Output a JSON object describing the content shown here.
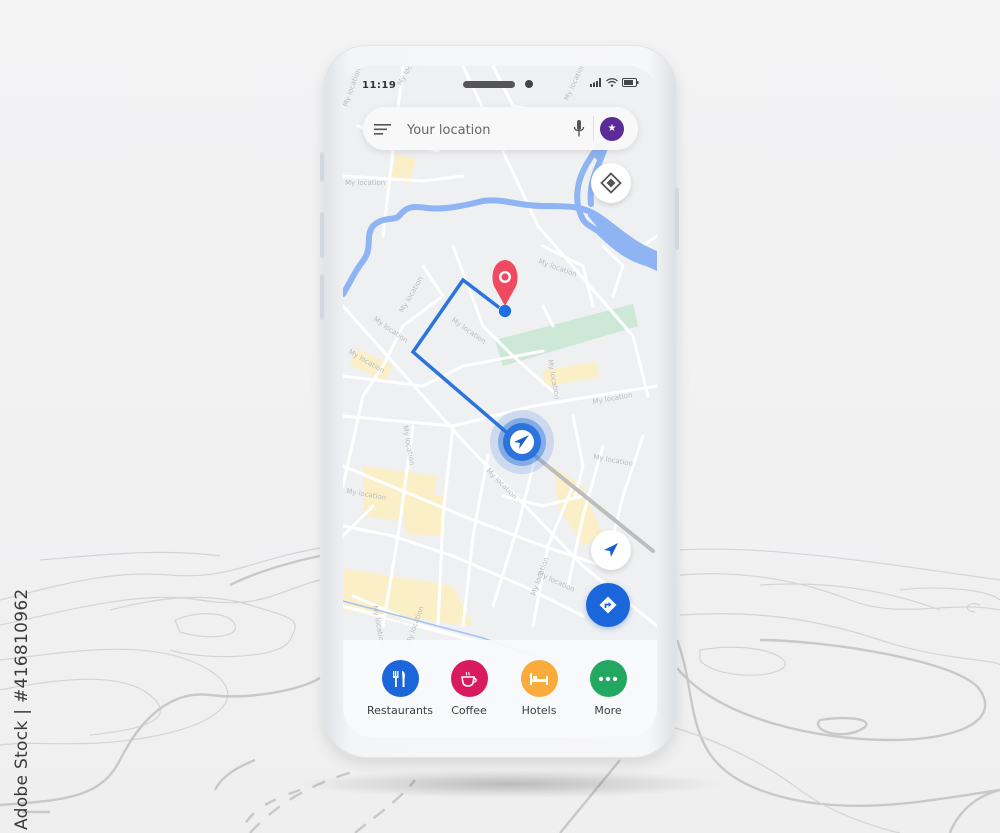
{
  "watermark": {
    "text": "Adobe Stock | #416810962"
  },
  "status_bar": {
    "time": "11:19",
    "icons": [
      "signal-icon",
      "wifi-icon",
      "battery-icon"
    ]
  },
  "search": {
    "placeholder": "Your location",
    "menu_icon": "menu-icon",
    "mic_icon": "microphone-icon",
    "avatar_glyph": "★",
    "avatar_color": "#5b2b98"
  },
  "map": {
    "street_label": "My location",
    "colors": {
      "background": "#eff0f2",
      "road": "#ffffff",
      "river": "#8fb4f3",
      "park": "#cde8d6",
      "building": "#fbefc8",
      "route": "#2a74dc",
      "destination_pin": "#ef4a5f",
      "rail": "#bdbdbd"
    },
    "destination_pin": "destination-pin-icon",
    "current_location": "navigation-arrow-icon"
  },
  "controls": {
    "layers_button": "layers-icon",
    "locate_button": "navigation-arrow-icon",
    "directions_button": "directions-icon",
    "directions_color": "#1a66da"
  },
  "categories": [
    {
      "label": "Restaurants",
      "icon": "restaurant-icon",
      "color": "#1a66da"
    },
    {
      "label": "Coffee",
      "icon": "coffee-icon",
      "color": "#d81b5f"
    },
    {
      "label": "Hotels",
      "icon": "hotel-icon",
      "color": "#f9ab3c"
    },
    {
      "label": "More",
      "icon": "more-icon",
      "color": "#22a861"
    }
  ]
}
